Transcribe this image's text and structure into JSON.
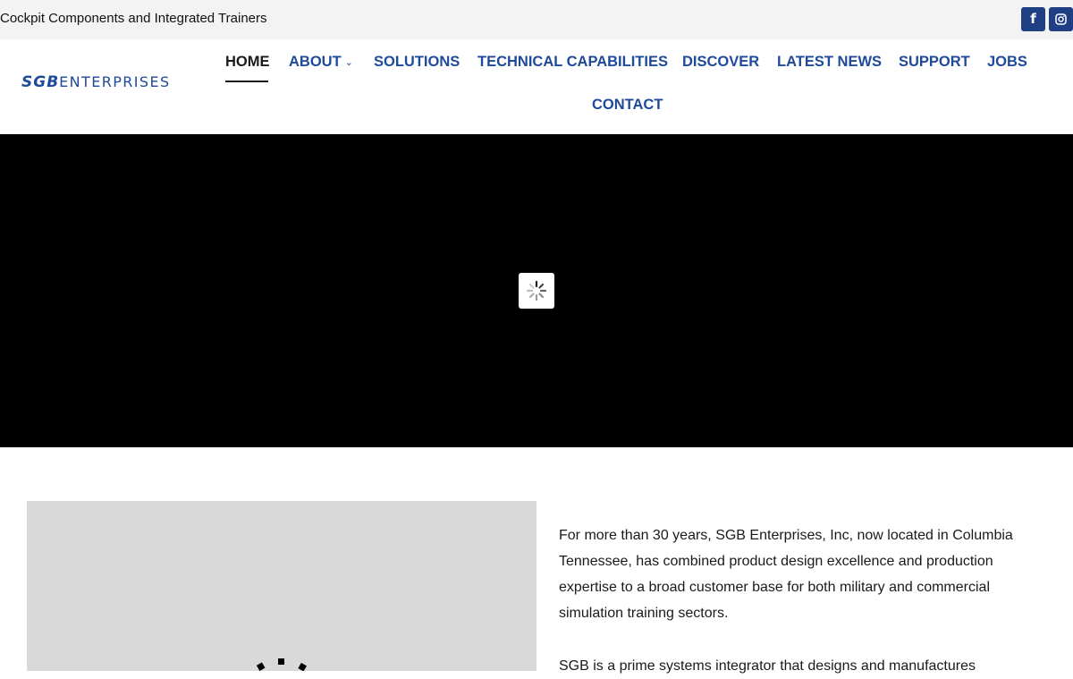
{
  "topbar": {
    "tagline": "Cockpit Components and Integrated Trainers",
    "social": [
      {
        "icon": "facebook-icon",
        "glyph": "f"
      },
      {
        "icon": "instagram-icon"
      }
    ]
  },
  "header": {
    "logo_bold": "SGB",
    "logo_light": "ENTERPRISES",
    "nav": {
      "home": "HOME",
      "about": "ABOUT",
      "solutions": "SOLUTIONS",
      "technical": "TECHNICAL CAPABILITIES",
      "discover": "DISCOVER",
      "news": "LATEST NEWS",
      "support": "SUPPORT",
      "jobs": "JOBS",
      "contact": "CONTACT"
    }
  },
  "content": {
    "paragraph1": "For more than 30 years, SGB Enterprises, Inc, now located in Columbia Tennessee, has combined product design excellence and production expertise to a broad customer base for both military and commercial simulation training sectors.",
    "paragraph2": "SGB is a prime systems integrator that designs and manufactures"
  },
  "colors": {
    "brand_blue": "#1f4a9a",
    "social_blue": "#1f3f85",
    "hero_bg": "#000000",
    "media_bg": "#d9d9d9"
  }
}
